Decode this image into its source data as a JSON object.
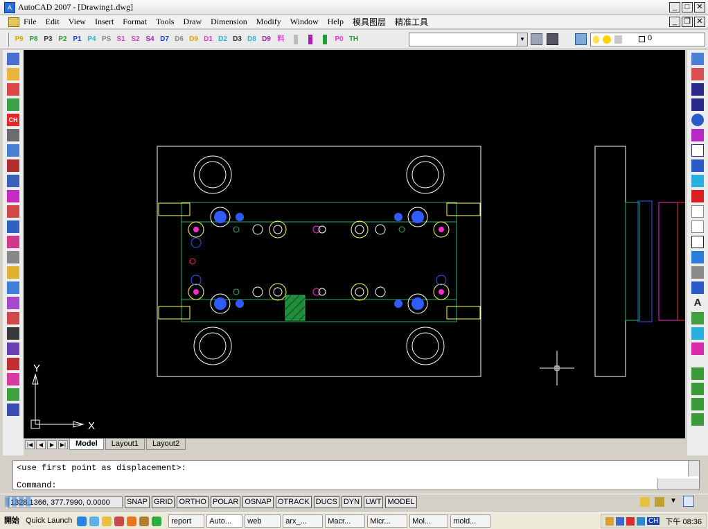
{
  "window": {
    "title": "AutoCAD 2007 - [Drawing1.dwg]"
  },
  "menu": [
    "File",
    "Edit",
    "View",
    "Insert",
    "Format",
    "Tools",
    "Draw",
    "Dimension",
    "Modify",
    "Window",
    "Help",
    "模具图层",
    "精准工具"
  ],
  "toolbar_buttons": [
    "P9",
    "P8",
    "P3",
    "P2",
    "P1",
    "P4",
    "PS",
    "S1",
    "S2",
    "S4",
    "D7",
    "D6",
    "D9",
    "D1",
    "D2",
    "D3",
    "D8",
    "D9",
    "料",
    "",
    "",
    "",
    "P0",
    "TH"
  ],
  "layer_combo": {
    "value": "0"
  },
  "command": {
    "line1": "<use first point as displacement>:",
    "line2": "Command:"
  },
  "layout_tabs": [
    "Model",
    "Layout1",
    "Layout2"
  ],
  "status": {
    "coords": "1328.1366, 377.7990, 0.0000",
    "buttons": [
      "SNAP",
      "GRID",
      "ORTHO",
      "POLAR",
      "OSNAP",
      "OTRACK",
      "DUCS",
      "DYN",
      "LWT",
      "MODEL"
    ]
  },
  "ucs": {
    "x_label": "X",
    "y_label": "Y"
  },
  "taskbar": {
    "start": "開始",
    "quick_launch": "Quick Launch",
    "tasks": [
      "report",
      "Auto...",
      "web",
      "arx_...",
      "Macr...",
      "Micr...",
      "Mol...",
      "mold..."
    ],
    "clock": "下午 08:36",
    "tray_lang": "CH"
  },
  "colors": {
    "canvas_bg": "#000000",
    "drawing_white": "#ffffff",
    "plate_green": "#2db55d",
    "accent_blue": "#2f5bff",
    "accent_magenta": "#ff2bd0",
    "accent_yellow": "#ffff66"
  }
}
